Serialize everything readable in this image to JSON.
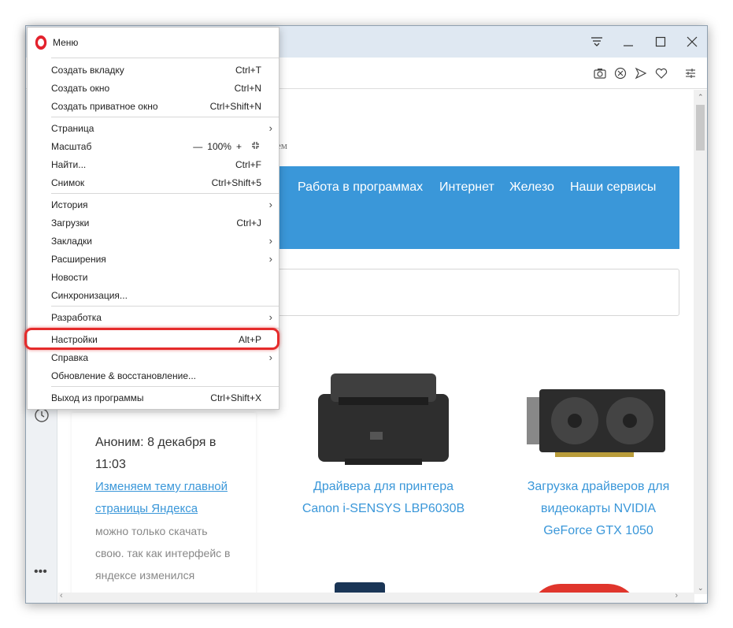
{
  "menu": {
    "title": "Меню",
    "items": [
      {
        "label": "Создать вкладку",
        "shortcut": "Ctrl+T"
      },
      {
        "label": "Создать окно",
        "shortcut": "Ctrl+N"
      },
      {
        "label": "Создать приватное окно",
        "shortcut": "Ctrl+Shift+N"
      },
      {
        "label": "Страница",
        "shortcut": ""
      },
      {
        "label": "Масштаб",
        "shortcut": ""
      },
      {
        "label": "Найти...",
        "shortcut": "Ctrl+F"
      },
      {
        "label": "Снимок",
        "shortcut": "Ctrl+Shift+5"
      },
      {
        "label": "История",
        "shortcut": ""
      },
      {
        "label": "Загрузки",
        "shortcut": "Ctrl+J"
      },
      {
        "label": "Закладки",
        "shortcut": ""
      },
      {
        "label": "Расширения",
        "shortcut": ""
      },
      {
        "label": "Новости",
        "shortcut": ""
      },
      {
        "label": "Синхронизация...",
        "shortcut": ""
      },
      {
        "label": "Разработка",
        "shortcut": ""
      },
      {
        "label": "Настройки",
        "shortcut": "Alt+P"
      },
      {
        "label": "Справка",
        "shortcut": ""
      },
      {
        "label": "Обновление & восстановление...",
        "shortcut": ""
      },
      {
        "label": "Выход из программы",
        "shortcut": "Ctrl+Shift+X"
      }
    ],
    "zoom": {
      "minus": "—",
      "value": "100%",
      "plus": "+"
    }
  },
  "content": {
    "subtitle_fragment": "ем",
    "nav": [
      "Работа в программах",
      "Интернет",
      "Железо",
      "Наши сервисы"
    ],
    "comment": {
      "author": "Аноним: 8 декабря в 11:03",
      "link": "Изменяем тему главной страницы Яндекса",
      "text": "можно только скачать свою. так как интерфейс в яндексе изменился"
    },
    "cards": [
      {
        "title": "Драйвера для принтера Canon i-SENSYS LBP6030B"
      },
      {
        "title": "Загрузка драйверов для видеокарты NVIDIA GeForce GTX 1050"
      }
    ]
  },
  "colors": {
    "accent": "#3a97d9",
    "opera_red": "#e3222d",
    "highlight": "#e52b2b"
  }
}
